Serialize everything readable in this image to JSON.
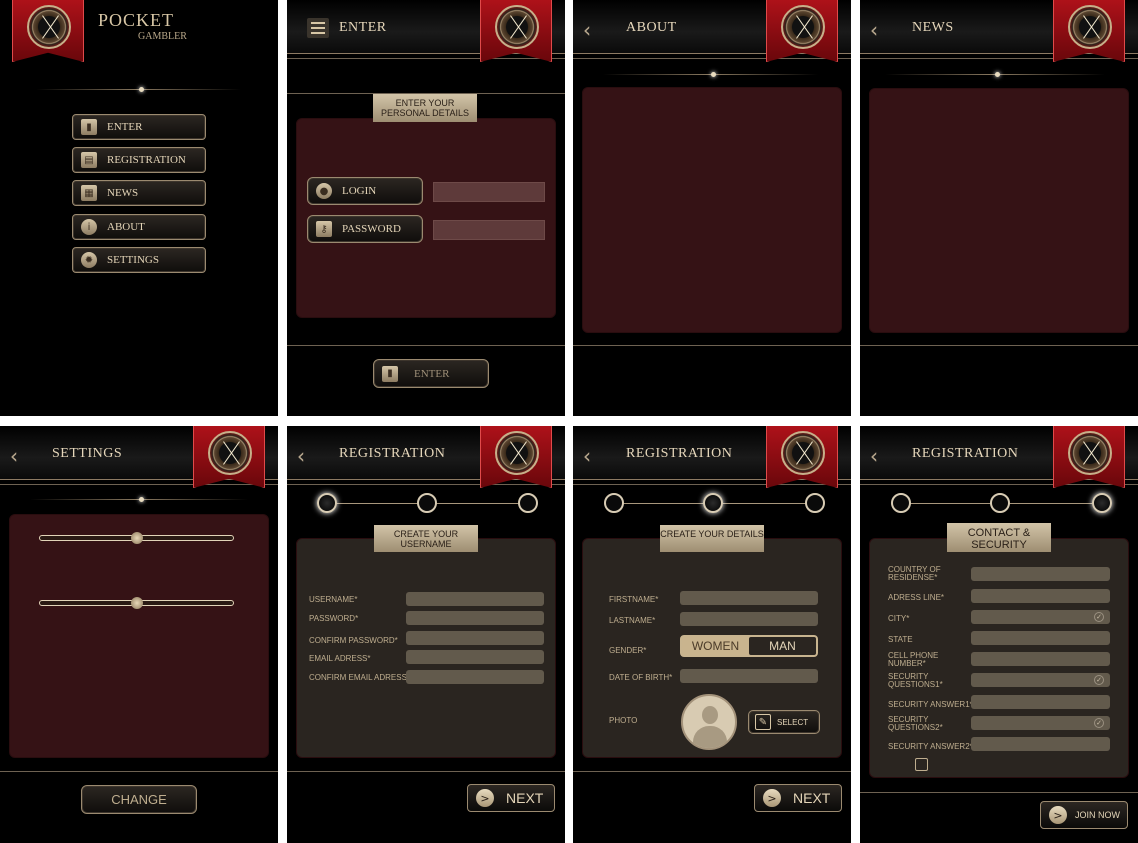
{
  "logo": {
    "line1": "POCKET",
    "line2": "GAMBLER"
  },
  "menu": [
    {
      "label": "ENTER",
      "icon": "door-icon"
    },
    {
      "label": "REGISTRATION",
      "icon": "register-icon"
    },
    {
      "label": "NEWS",
      "icon": "news-icon"
    },
    {
      "label": "ABOUT",
      "icon": "info-icon"
    },
    {
      "label": "SETTINGS",
      "icon": "gear-icon"
    }
  ],
  "enter": {
    "title": "ENTER",
    "tag": "ENTER YOUR PERSONAL DETAILS",
    "login_label": "LOGIN",
    "password_label": "PASSWORD",
    "enter_button": "ENTER"
  },
  "about": {
    "title": "ABOUT"
  },
  "news": {
    "title": "NEWS"
  },
  "settings": {
    "title": "SETTINGS",
    "slider1": 0.48,
    "slider2": 0.48,
    "change_button": "CHANGE"
  },
  "reg1": {
    "title": "REGISTRATION",
    "tag": "CREATE YOUR USERNAME",
    "fields": [
      "USERNAME*",
      "PASSWORD*",
      "CONFIRM PASSWORD*",
      "EMAIL ADRESS*",
      "CONFIRM EMAIL ADRESS*"
    ],
    "next": "NEXT"
  },
  "reg2": {
    "title": "REGISTRATION",
    "tag": "CREATE YOUR DETAILS",
    "firstname": "FIRSTNAME*",
    "lastname": "LASTNAME*",
    "gender": "GENDER*",
    "women": "WOMEN",
    "man": "MAN",
    "dob": "DATE OF BIRTH*",
    "photo": "PHOTO",
    "select": "SELECT",
    "next": "NEXT"
  },
  "reg3": {
    "title": "REGISTRATION",
    "tag": "CONTACT & SECURITY",
    "fields": [
      "COUNTRY OF RESIDENSE*",
      "ADRESS LINE*",
      "CITY*",
      "STATE",
      "CELL PHONE NUMBER*",
      "SECURITY QUESTIONS1*",
      "SECURITY ANSWER1*",
      "SECURITY QUESTIONS2*",
      "SECURITY ANSWER2*"
    ],
    "join": "JOIN NOW"
  },
  "colors": {
    "panel_red": "#351215",
    "panel_brown": "#2a2520",
    "ribbon": "#b1121a",
    "accent": "#d8c7a6"
  }
}
